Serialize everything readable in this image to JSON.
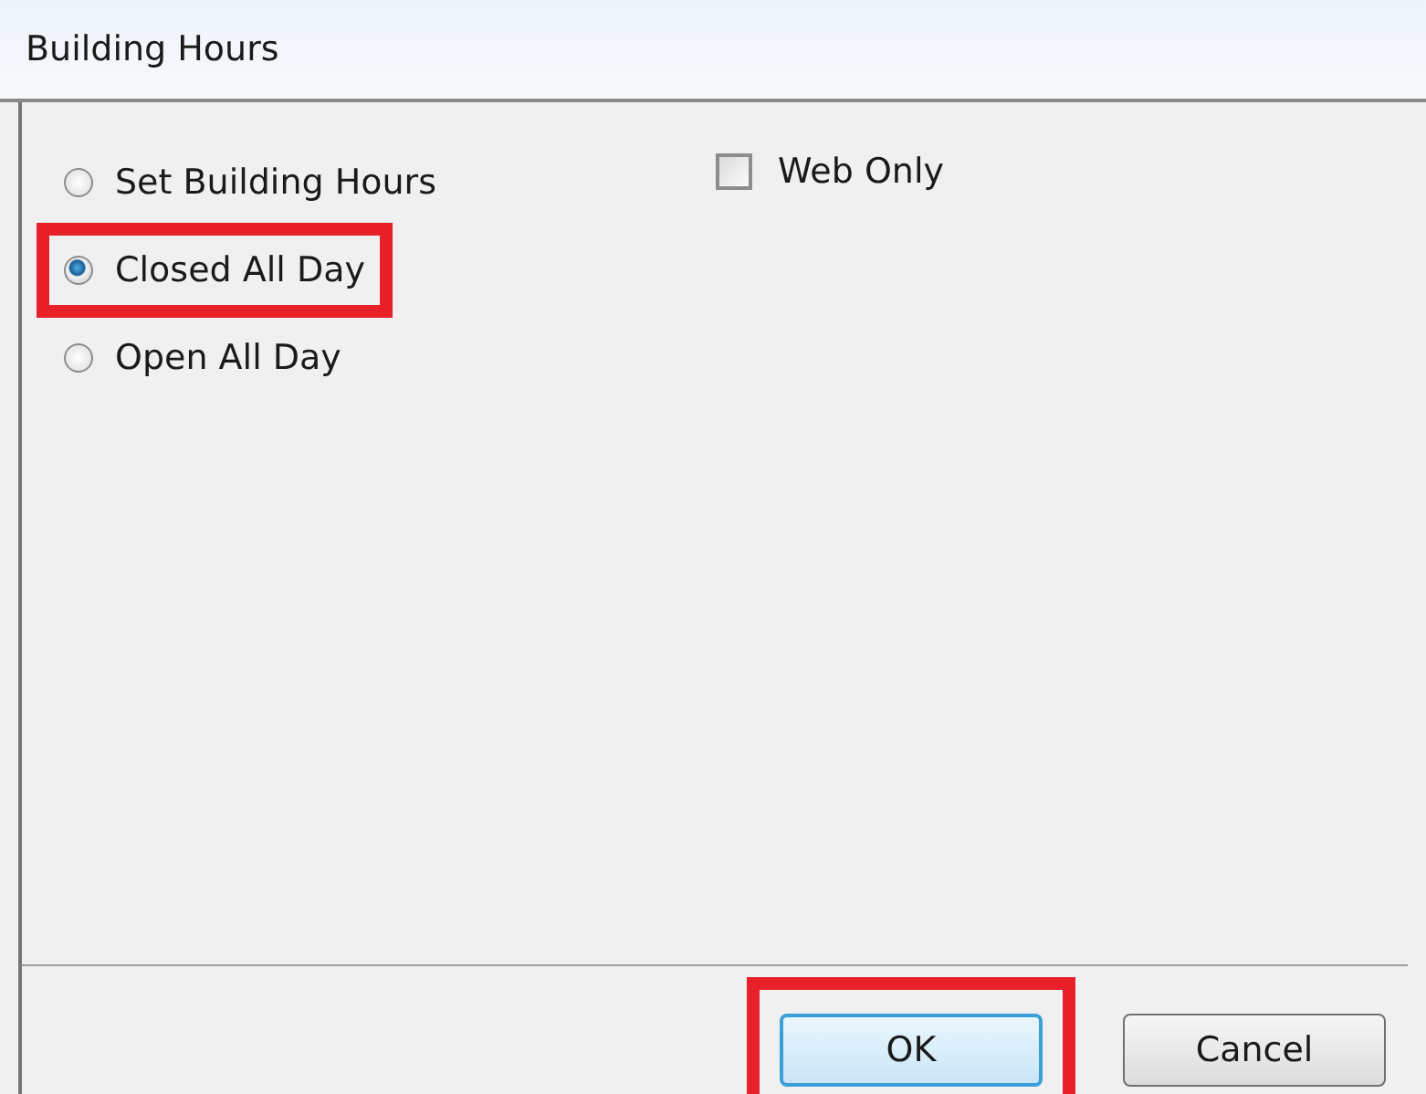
{
  "window": {
    "title": "Building Hours"
  },
  "options": [
    {
      "label": "Set Building Hours",
      "selected": false,
      "highlighted": false
    },
    {
      "label": "Closed All Day",
      "selected": true,
      "highlighted": true
    },
    {
      "label": "Open All Day",
      "selected": false,
      "highlighted": false
    }
  ],
  "web_only": {
    "label": "Web Only",
    "checked": false
  },
  "buttons": [
    {
      "label": "OK",
      "default": true,
      "highlighted": true
    },
    {
      "label": "Cancel",
      "default": false,
      "highlighted": false
    }
  ]
}
